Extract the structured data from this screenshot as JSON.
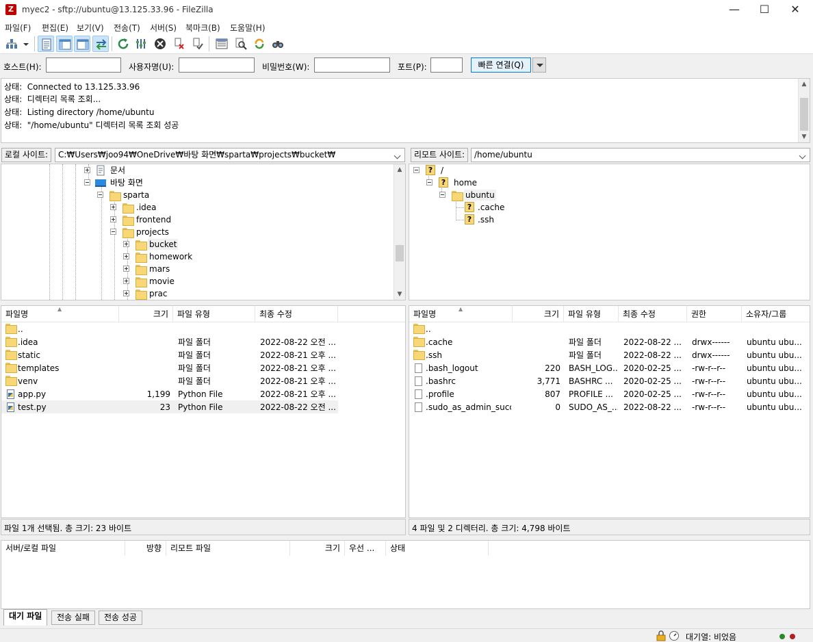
{
  "window": {
    "title": "myec2 - sftp://ubuntu@13.125.33.96 - FileZilla",
    "app_icon_letter": "Z",
    "minimize": "—",
    "maximize": "☐",
    "close": "✕"
  },
  "menu": [
    "파일(F)",
    "편집(E)",
    "보기(V)",
    "전송(T)",
    "서버(S)",
    "북마크(B)",
    "도움말(H)"
  ],
  "toolbar": {
    "icons": [
      "site-manager-icon",
      "site-manager-dropdown-icon",
      "toggle-message-log-icon",
      "toggle-local-tree-icon",
      "toggle-remote-tree-icon",
      "toggle-transfer-queue-icon",
      "refresh-icon",
      "process-queue-icon",
      "cancel-icon",
      "disconnect-icon",
      "reconnect-icon",
      "directory-listing-filters-icon",
      "toggle-directory-comparison-icon",
      "synchronized-browsing-icon",
      "search-remote-files-icon"
    ]
  },
  "quickconnect": {
    "host_label": "호스트(H):",
    "host_value": "",
    "user_label": "사용자명(U):",
    "user_value": "",
    "pass_label": "비밀번호(W):",
    "pass_value": "",
    "port_label": "포트(P):",
    "port_value": "",
    "connect_label": "빠른 연결(Q)"
  },
  "log": [
    {
      "prefix": "상태:",
      "text": "Connected to 13.125.33.96"
    },
    {
      "prefix": "상태:",
      "text": "디렉터리 목록 조회..."
    },
    {
      "prefix": "상태:",
      "text": "Listing directory /home/ubuntu"
    },
    {
      "prefix": "상태:",
      "text": "\"/home/ubuntu\" 디렉터리 목록 조회 성공"
    }
  ],
  "local": {
    "site_label": "로컬 사이트:",
    "path": "C:₩Users₩joo94₩OneDrive₩바탕 화면₩sparta₩projects₩bucket₩",
    "tree": [
      {
        "label": "문서",
        "icon": "documents-icon"
      },
      {
        "label": "바탕 화면",
        "icon": "desktop-icon"
      },
      {
        "label": "sparta",
        "icon": "folder-icon"
      },
      {
        "label": ".idea",
        "icon": "folder-icon"
      },
      {
        "label": "frontend",
        "icon": "folder-icon"
      },
      {
        "label": "projects",
        "icon": "folder-icon"
      },
      {
        "label": "bucket",
        "icon": "folder-icon"
      },
      {
        "label": "homework",
        "icon": "folder-icon"
      },
      {
        "label": "mars",
        "icon": "folder-icon"
      },
      {
        "label": "movie",
        "icon": "folder-icon"
      },
      {
        "label": "prac",
        "icon": "folder-icon"
      }
    ],
    "columns": [
      "파일명",
      "크기",
      "파일 유형",
      "최종 수정"
    ],
    "files": [
      {
        "name": "..",
        "size": "",
        "type": "",
        "modified": "",
        "icon": "folder-icon"
      },
      {
        "name": ".idea",
        "size": "",
        "type": "파일 폴더",
        "modified": "2022-08-22 오전 ...",
        "icon": "folder-icon"
      },
      {
        "name": "static",
        "size": "",
        "type": "파일 폴더",
        "modified": "2022-08-21 오후 ...",
        "icon": "folder-icon"
      },
      {
        "name": "templates",
        "size": "",
        "type": "파일 폴더",
        "modified": "2022-08-21 오후 ...",
        "icon": "folder-icon"
      },
      {
        "name": "venv",
        "size": "",
        "type": "파일 폴더",
        "modified": "2022-08-21 오후 ...",
        "icon": "folder-icon"
      },
      {
        "name": "app.py",
        "size": "1,199",
        "type": "Python File",
        "modified": "2022-08-21 오후 ...",
        "icon": "python-file-icon"
      },
      {
        "name": "test.py",
        "size": "23",
        "type": "Python File",
        "modified": "2022-08-22 오전 ...",
        "icon": "python-file-icon"
      }
    ],
    "status": "파일 1개 선택됨. 총 크기: 23 바이트"
  },
  "remote": {
    "site_label": "리모트 사이트:",
    "path": "/home/ubuntu",
    "tree": [
      {
        "label": "/",
        "icon": "unknown-folder-icon"
      },
      {
        "label": "home",
        "icon": "unknown-folder-icon"
      },
      {
        "label": "ubuntu",
        "icon": "folder-icon"
      },
      {
        "label": ".cache",
        "icon": "unknown-folder-icon"
      },
      {
        "label": ".ssh",
        "icon": "unknown-folder-icon"
      }
    ],
    "columns": [
      "파일명",
      "크기",
      "파일 유형",
      "최종 수정",
      "권한",
      "소유자/그룹"
    ],
    "files": [
      {
        "name": "..",
        "size": "",
        "type": "",
        "modified": "",
        "perms": "",
        "owner": "",
        "icon": "folder-icon"
      },
      {
        "name": ".cache",
        "size": "",
        "type": "파일 폴더",
        "modified": "2022-08-22 ...",
        "perms": "drwx------",
        "owner": "ubuntu ubu...",
        "icon": "folder-icon"
      },
      {
        "name": ".ssh",
        "size": "",
        "type": "파일 폴더",
        "modified": "2022-08-22 ...",
        "perms": "drwx------",
        "owner": "ubuntu ubu...",
        "icon": "folder-icon"
      },
      {
        "name": ".bash_logout",
        "size": "220",
        "type": "BASH_LOG...",
        "modified": "2020-02-25 ...",
        "perms": "-rw-r--r--",
        "owner": "ubuntu ubu...",
        "icon": "file-icon"
      },
      {
        "name": ".bashrc",
        "size": "3,771",
        "type": "BASHRC ...",
        "modified": "2020-02-25 ...",
        "perms": "-rw-r--r--",
        "owner": "ubuntu ubu...",
        "icon": "file-icon"
      },
      {
        "name": ".profile",
        "size": "807",
        "type": "PROFILE ...",
        "modified": "2020-02-25 ...",
        "perms": "-rw-r--r--",
        "owner": "ubuntu ubu...",
        "icon": "file-icon"
      },
      {
        "name": ".sudo_as_admin_succ...",
        "size": "0",
        "type": "SUDO_AS_...",
        "modified": "2022-08-22 ...",
        "perms": "-rw-r--r--",
        "owner": "ubuntu ubu...",
        "icon": "file-icon"
      }
    ],
    "status": "4 파일 및 2 디렉터리. 총 크기: 4,798 바이트"
  },
  "queue": {
    "columns": [
      "서버/로컬 파일",
      "방향",
      "리모트 파일",
      "크기",
      "우선 ...",
      "상태"
    ]
  },
  "tabs": [
    "대기 파일",
    "전송 실패",
    "전송 성공"
  ],
  "statusbar": {
    "queue_text": "대기열: 비었음",
    "lock_icon": "lock-icon",
    "speed_icon": "speed-limit-icon",
    "led_colors": [
      "#2a8a2a",
      "#b02020"
    ]
  },
  "colors": {
    "accent": "#0078d7",
    "folder": "#f8d876"
  }
}
